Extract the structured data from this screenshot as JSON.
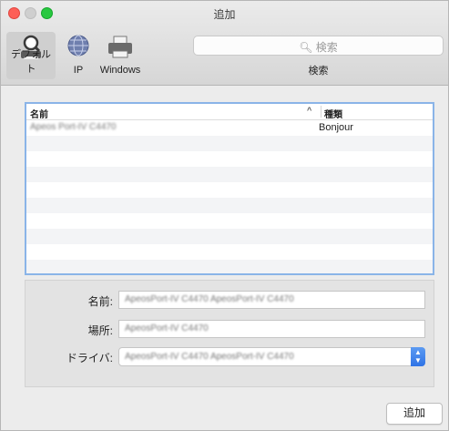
{
  "window": {
    "title": "追加"
  },
  "toolbar": {
    "items": [
      {
        "label": "デフォルト",
        "icon": "default-printer-magnifier-icon",
        "selected": true
      },
      {
        "label": "IP",
        "icon": "globe-icon",
        "selected": false
      },
      {
        "label": "Windows",
        "icon": "printer-icon",
        "selected": false
      }
    ],
    "search": {
      "placeholder": "検索",
      "caption": "検索"
    }
  },
  "printer_list": {
    "columns": {
      "name": "名前",
      "kind": "種類"
    },
    "rows": [
      {
        "name": "Apeos Port-IV C4470",
        "kind": "Bonjour"
      }
    ]
  },
  "form": {
    "name_label": "名前:",
    "name_value": "ApeosPort-IV C4470 ApeosPort-IV C4470",
    "location_label": "場所:",
    "location_value": "ApeosPort-IV C4470",
    "driver_label": "ドライバ:",
    "driver_value": "ApeosPort-IV C4470 ApeosPort-IV C4470"
  },
  "actions": {
    "add_label": "追加"
  }
}
